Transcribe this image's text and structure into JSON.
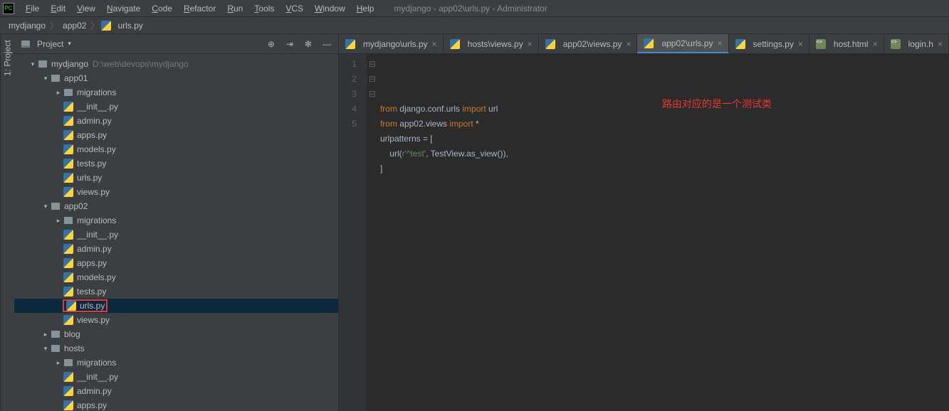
{
  "menubar": {
    "items": [
      "File",
      "Edit",
      "View",
      "Navigate",
      "Code",
      "Refactor",
      "Run",
      "Tools",
      "VCS",
      "Window",
      "Help"
    ],
    "title": "mydjango - app02\\urls.py - Administrator"
  },
  "breadcrumb": {
    "parts": [
      "mydjango",
      "app02",
      "urls.py"
    ]
  },
  "sidepanel": {
    "label": "1: Project"
  },
  "projectPanel": {
    "title": "Project",
    "tree": [
      {
        "depth": 0,
        "arrow": "▾",
        "icon": "dir",
        "label": "mydjango",
        "hint": "D:\\web\\devops\\mydjango"
      },
      {
        "depth": 1,
        "arrow": "▾",
        "icon": "dir",
        "label": "app01"
      },
      {
        "depth": 2,
        "arrow": "▸",
        "icon": "dir",
        "label": "migrations"
      },
      {
        "depth": 2,
        "arrow": "",
        "icon": "py",
        "label": "__init__.py"
      },
      {
        "depth": 2,
        "arrow": "",
        "icon": "py",
        "label": "admin.py"
      },
      {
        "depth": 2,
        "arrow": "",
        "icon": "py",
        "label": "apps.py"
      },
      {
        "depth": 2,
        "arrow": "",
        "icon": "py",
        "label": "models.py"
      },
      {
        "depth": 2,
        "arrow": "",
        "icon": "py",
        "label": "tests.py"
      },
      {
        "depth": 2,
        "arrow": "",
        "icon": "py",
        "label": "urls.py"
      },
      {
        "depth": 2,
        "arrow": "",
        "icon": "py",
        "label": "views.py"
      },
      {
        "depth": 1,
        "arrow": "▾",
        "icon": "dir",
        "label": "app02"
      },
      {
        "depth": 2,
        "arrow": "▸",
        "icon": "dir",
        "label": "migrations"
      },
      {
        "depth": 2,
        "arrow": "",
        "icon": "py",
        "label": "__init__.py"
      },
      {
        "depth": 2,
        "arrow": "",
        "icon": "py",
        "label": "admin.py"
      },
      {
        "depth": 2,
        "arrow": "",
        "icon": "py",
        "label": "apps.py"
      },
      {
        "depth": 2,
        "arrow": "",
        "icon": "py",
        "label": "models.py"
      },
      {
        "depth": 2,
        "arrow": "",
        "icon": "py",
        "label": "tests.py"
      },
      {
        "depth": 2,
        "arrow": "",
        "icon": "py",
        "label": "urls.py",
        "selected": true,
        "highlight": true
      },
      {
        "depth": 2,
        "arrow": "",
        "icon": "py",
        "label": "views.py"
      },
      {
        "depth": 1,
        "arrow": "▸",
        "icon": "dir",
        "label": "blog"
      },
      {
        "depth": 1,
        "arrow": "▾",
        "icon": "dir",
        "label": "hosts"
      },
      {
        "depth": 2,
        "arrow": "▸",
        "icon": "dir",
        "label": "migrations"
      },
      {
        "depth": 2,
        "arrow": "",
        "icon": "py",
        "label": "__init__.py"
      },
      {
        "depth": 2,
        "arrow": "",
        "icon": "py",
        "label": "admin.py"
      },
      {
        "depth": 2,
        "arrow": "",
        "icon": "py",
        "label": "apps.py"
      }
    ]
  },
  "tabs": [
    {
      "icon": "py",
      "label": "mydjango\\urls.py"
    },
    {
      "icon": "py",
      "label": "hosts\\views.py"
    },
    {
      "icon": "py",
      "label": "app02\\views.py"
    },
    {
      "icon": "py",
      "label": "app02\\urls.py",
      "active": true
    },
    {
      "icon": "py",
      "label": "settings.py"
    },
    {
      "icon": "html",
      "label": "host.html"
    },
    {
      "icon": "html",
      "label": "login.h"
    }
  ],
  "code": {
    "lines": [
      {
        "n": "1",
        "fold": "⊟",
        "tokens": [
          [
            "kw",
            "from"
          ],
          [
            "op",
            " "
          ],
          [
            "id",
            "django.conf.urls"
          ],
          [
            "op",
            " "
          ],
          [
            "kw",
            "import"
          ],
          [
            "op",
            " "
          ],
          [
            "id",
            "url"
          ]
        ]
      },
      {
        "n": "2",
        "fold": "",
        "tokens": [
          [
            "kw",
            "from"
          ],
          [
            "op",
            " "
          ],
          [
            "id",
            "app02.views"
          ],
          [
            "op",
            " "
          ],
          [
            "kw",
            "import"
          ],
          [
            "op",
            " "
          ],
          [
            "op",
            "*"
          ]
        ]
      },
      {
        "n": "3",
        "fold": "⊟",
        "tokens": [
          [
            "id",
            "urlpatterns "
          ],
          [
            "op",
            "= ["
          ]
        ]
      },
      {
        "n": "4",
        "fold": "",
        "tokens": [
          [
            "op",
            "    "
          ],
          [
            "id",
            "url"
          ],
          [
            "op",
            "("
          ],
          [
            "str",
            "r'^test'"
          ],
          [
            "op",
            ", "
          ],
          [
            "id",
            "TestView.as_view"
          ],
          [
            "op",
            "()),"
          ]
        ]
      },
      {
        "n": "5",
        "fold": "⊟",
        "tokens": [
          [
            "op",
            "]"
          ]
        ]
      }
    ],
    "annotation": "路由对应的是一个测试类"
  }
}
